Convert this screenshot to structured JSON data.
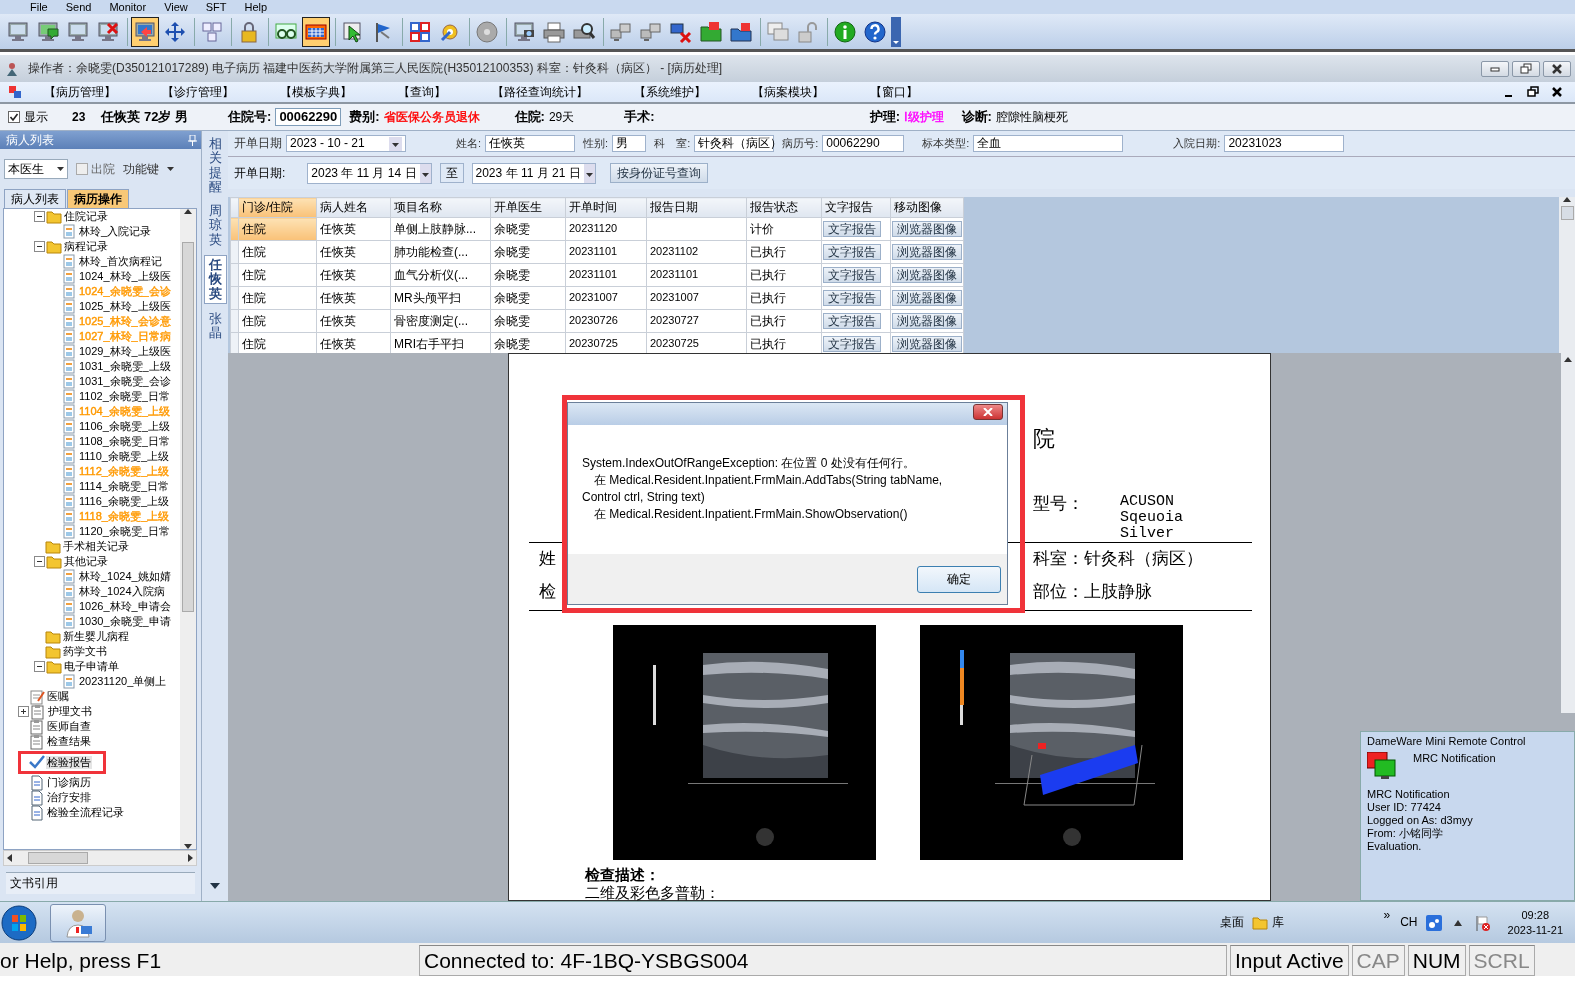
{
  "menu_bar": [
    "File",
    "Send",
    "Monitor",
    "View",
    "SFT",
    "Help"
  ],
  "toolbar": [
    {
      "pressed": false
    },
    {
      "pressed": false
    },
    {
      "pressed": false
    },
    {
      "pressed": false
    },
    {
      "pressed": true
    },
    {
      "pressed": false
    },
    {
      "pressed": false
    },
    {
      "pressed": false
    },
    {
      "pressed": false
    },
    {
      "pressed": true
    },
    {
      "pressed": false
    },
    {
      "pressed": false
    },
    {
      "pressed": false
    },
    {
      "pressed": false
    },
    {
      "pressed": false
    },
    {
      "pressed": false
    },
    {
      "pressed": false
    },
    {
      "pressed": false
    },
    {
      "pressed": false
    },
    {
      "pressed": false
    },
    {
      "pressed": false
    },
    {
      "pressed": false
    },
    {
      "pressed": false
    },
    {
      "pressed": false
    },
    {
      "pressed": false
    },
    {
      "pressed": false
    },
    {
      "pressed": false
    }
  ],
  "window": {
    "title": "操作者：余晓雯(D350121017289) 电子病历  福建中医药大学附属第三人民医院(H35012100353)  科室：针灸科（病区） - [病历处理]"
  },
  "menu": [
    "【病历管理】",
    "【诊疗管理】",
    "【模板字典】",
    "【查询】",
    "【路径查询统计】",
    "【系统维护】",
    "【病案模块】",
    "【窗口】"
  ],
  "patient": {
    "show_checkbox": {
      "label": "显示",
      "checked": true
    },
    "bed": "23",
    "summary": "任恢英 72岁 男",
    "fields": [
      {
        "label": "住院号:",
        "value": "00062290",
        "kind": "input"
      },
      {
        "label": "费别:",
        "value": "省医保公务员退休",
        "kind": "text",
        "color": "#ff0000"
      },
      {
        "label": "住院:",
        "value": "29天",
        "kind": "text"
      },
      {
        "label": "手术:",
        "kind": "text"
      },
      {
        "label": "护理:",
        "value": "Ⅰ级护理",
        "kind": "text",
        "color": "#ff00ff"
      },
      {
        "label": "诊断:",
        "value": "腔隙性脑梗死",
        "kind": "text"
      }
    ]
  },
  "sidebar": {
    "title": "病人列表",
    "doctor_select": "本医生",
    "discharge_checkbox": {
      "label": "出院",
      "checked": false
    },
    "function_menu": "功能键",
    "tabs": [
      {
        "label": "病人列表",
        "selected": false
      },
      {
        "label": "病历操作",
        "selected": true
      }
    ],
    "tree": [
      {
        "children": [
          {
            "label": "住院记录",
            "kind": "folder",
            "expanded": true,
            "selected": false,
            "children": [
              {
                "label": "林玲_入院记录",
                "kind": "doc",
                "selected": false
              }
            ]
          },
          {
            "label": "病程记录",
            "kind": "folder",
            "expanded": true,
            "selected": false,
            "children": [
              {
                "label": "林玲_首次病程记",
                "kind": "doc",
                "selected": false
              },
              {
                "label": "1024_林玲_上级医",
                "kind": "doc",
                "selected": false
              },
              {
                "label": "1024_余晓雯_会诊",
                "kind": "doc",
                "selected": false,
                "color": "#ff9900"
              },
              {
                "label": "1025_林玲_上级医",
                "kind": "doc",
                "selected": false
              },
              {
                "label": "1025_林玲_会诊意",
                "kind": "doc",
                "selected": false,
                "color": "#ff9900"
              },
              {
                "label": "1027_林玲_日常病",
                "kind": "doc",
                "selected": false,
                "color": "#ff9900"
              },
              {
                "label": "1029_林玲_上级医",
                "kind": "doc",
                "selected": false
              },
              {
                "label": "1031_余晓雯_上级",
                "kind": "doc",
                "selected": false
              },
              {
                "label": "1031_余晓雯_会诊",
                "kind": "doc",
                "selected": false
              },
              {
                "label": "1102_余晓雯_日常",
                "kind": "doc",
                "selected": false
              },
              {
                "label": "1104_余晓雯_上级",
                "kind": "doc",
                "selected": false,
                "color": "#ff9900"
              },
              {
                "label": "1106_余晓雯_上级",
                "kind": "doc",
                "selected": false
              },
              {
                "label": "1108_余晓雯_日常",
                "kind": "doc",
                "selected": false
              },
              {
                "label": "1110_余晓雯_上级",
                "kind": "doc",
                "selected": false
              },
              {
                "label": "1112_余晓雯_上级",
                "kind": "doc",
                "selected": false,
                "color": "#ff9900"
              },
              {
                "label": "1114_余晓雯_日常",
                "kind": "doc",
                "selected": false
              },
              {
                "label": "1116_余晓雯_上级",
                "kind": "doc",
                "selected": false
              },
              {
                "label": "1118_余晓雯_上级",
                "kind": "doc",
                "selected": false,
                "color": "#ff9900"
              },
              {
                "label": "1120_余晓雯_日常",
                "kind": "doc",
                "selected": false
              }
            ]
          },
          {
            "label": "手术相关记录",
            "kind": "folder",
            "selected": false
          },
          {
            "label": "其他记录",
            "kind": "folder",
            "expanded": true,
            "selected": false,
            "children": [
              {
                "label": "林玲_1024_姚如婧",
                "kind": "doc",
                "selected": false
              },
              {
                "label": "林玲_1024入院病",
                "kind": "doc",
                "selected": false
              },
              {
                "label": "1026_林玲_申请会",
                "kind": "doc",
                "selected": false
              },
              {
                "label": "1030_余晓雯_申请",
                "kind": "doc",
                "selected": false
              }
            ]
          },
          {
            "label": "新生婴儿病程",
            "kind": "folder",
            "selected": false
          },
          {
            "label": "药学文书",
            "kind": "folder",
            "selected": false
          },
          {
            "label": "电子申请单",
            "kind": "folder",
            "expanded": true,
            "selected": false,
            "children": [
              {
                "label": "20231120_单侧上",
                "kind": "doc",
                "selected": false
              }
            ]
          }
        ]
      },
      {
        "label": "医嘱",
        "kind": "note",
        "selected": false
      },
      {
        "label": "护理文书",
        "kind": "clipboard",
        "expanded": false,
        "selected": false
      },
      {
        "label": "医师自查",
        "kind": "clipboard",
        "selected": false
      },
      {
        "label": "检查结果",
        "kind": "clipboard",
        "selected": false
      },
      {
        "label": "检验报告",
        "kind": "check",
        "selected": true
      },
      {
        "label": "门诊病历",
        "kind": "page",
        "selected": false
      },
      {
        "label": "治疗安排",
        "kind": "page",
        "selected": false
      },
      {
        "label": "检验全流程记录",
        "kind": "page",
        "selected": false
      }
    ],
    "footer": "文书引用"
  },
  "side_tabs": [
    {
      "label": "相关提醒",
      "selected": false
    },
    {
      "label": "周琼英",
      "selected": false
    },
    {
      "label": "任恢英",
      "selected": true
    },
    {
      "label": "张晶",
      "selected": false
    }
  ],
  "filter": {
    "fields": [
      {
        "label": "开单日期",
        "value": "2023 - 10 - 21",
        "kind": "select"
      },
      {
        "label": "姓名:",
        "value": "任恢英",
        "kind": "input"
      },
      {
        "label": "性别:",
        "value": "男",
        "kind": "input"
      },
      {
        "label": "科　室:",
        "value": "针灸科（病区）",
        "kind": "input"
      },
      {
        "label": "病历号:",
        "value": "00062290",
        "kind": "input"
      },
      {
        "label": "标本类型:",
        "value": "全血",
        "kind": "input"
      },
      {
        "label": "入院日期:",
        "value": "20231023",
        "kind": "input"
      }
    ],
    "range_label": "开单日期:",
    "date_from": "2023 年 11 月 14 日",
    "range_sep": "至",
    "date_to": "2023 年 11 月 21 日",
    "id_search_button": "按身份证号查询"
  },
  "table": {
    "columns": [
      "门诊/住院",
      "病人姓名",
      "项目名称",
      "开单医生",
      "开单时间",
      "报告日期",
      "报告状态",
      "文字报告",
      "移动图像"
    ],
    "rows": [
      {
        "selected": true,
        "cells": [
          "住院",
          "任恢英",
          "单侧上肢静脉...",
          "余晓雯",
          "20231120",
          null,
          "计价"
        ],
        "buttons": [
          "文字报告",
          "浏览器图像"
        ]
      },
      {
        "selected": false,
        "cells": [
          "住院",
          "任恢英",
          "肺功能检查(...",
          "余晓雯",
          "20231101",
          "20231102",
          "已执行"
        ],
        "buttons": [
          "文字报告",
          "浏览器图像"
        ]
      },
      {
        "selected": false,
        "cells": [
          "住院",
          "任恢英",
          "血气分析仪(...",
          "余晓雯",
          "20231101",
          "20231101",
          "已执行"
        ],
        "buttons": [
          "文字报告",
          "浏览器图像"
        ]
      },
      {
        "selected": false,
        "cells": [
          "住院",
          "任恢英",
          "MR头颅平扫",
          "余晓雯",
          "20231007",
          "20231007",
          "已执行"
        ],
        "buttons": [
          "文字报告",
          "浏览器图像"
        ]
      },
      {
        "selected": false,
        "cells": [
          "住院",
          "任恢英",
          "骨密度测定(...",
          "余晓雯",
          "20230726",
          "20230727",
          "已执行"
        ],
        "buttons": [
          "文字报告",
          "浏览器图像"
        ]
      },
      {
        "selected": false,
        "cells": [
          "住院",
          "任恢英",
          "MRI右手平扫",
          "余晓雯",
          "20230725",
          "20230725",
          "已执行"
        ],
        "buttons": [
          "文字报告",
          "浏览器图像"
        ]
      }
    ]
  },
  "report": {
    "heading": "院",
    "device_label": "型号：",
    "device": "ACUSON Sqeuoia Silver",
    "name_label": "姓",
    "department": "科室：针灸科（病区）",
    "exam_label": "检",
    "site": "部位：上肢静脉",
    "section_title": "检查描述：",
    "section_text": "二维及彩色多普勒："
  },
  "dialog": {
    "lines": [
      "System.IndexOutOfRangeException: 在位置 0 处没有任何行。",
      "在 Medical.Resident.Inpatient.FrmMain.AddTabs(String tabName, Control ctrl, String text)",
      "在 Medical.Resident.Inpatient.FrmMain.ShowObservation()"
    ],
    "button": "确定"
  },
  "notification": {
    "app": "DameWare Mini Remote Control",
    "heading": "MRC Notification",
    "lines": [
      "MRC Notification",
      "User ID: 77424",
      "Logged on As: d3myy",
      "From: 小铭同学",
      "Evaluation."
    ]
  },
  "taskbar": {
    "toolbar_label": "桌面",
    "library": "库",
    "more": "»",
    "language": "CH",
    "time": "09:28",
    "date": "2023-11-21"
  },
  "status_bar": [
    "or Help, press F1",
    "Connected to: 4F-1BQ-YSBGS004",
    "Input Active",
    "CAP",
    "NUM",
    "SCRL"
  ]
}
